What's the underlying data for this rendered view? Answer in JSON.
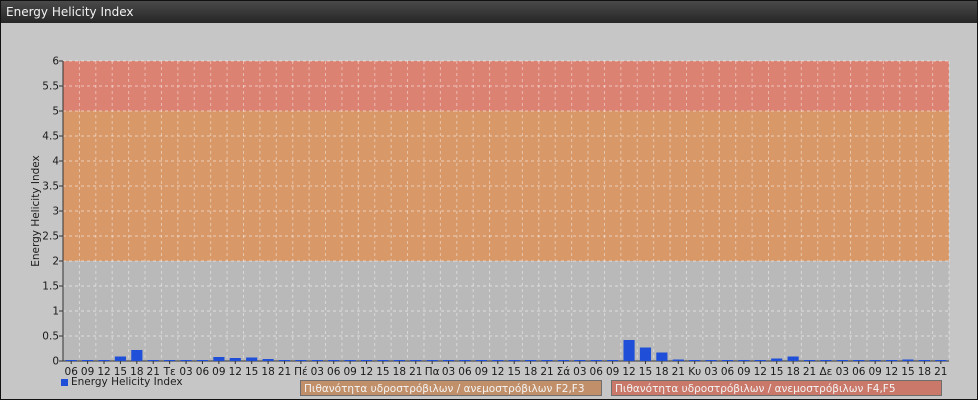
{
  "window": {
    "title": "Energy Helicity Index"
  },
  "chart_data": {
    "type": "bar",
    "ylabel": "Energy Helicity Index",
    "ylim": [
      0,
      6
    ],
    "yticks": [
      0,
      0.5,
      1,
      1.5,
      2,
      2.5,
      3,
      3.5,
      4,
      4.5,
      5,
      5.5,
      6
    ],
    "grid": true,
    "categories": [
      "06",
      "09",
      "12",
      "15",
      "18",
      "21",
      "Τε",
      "03",
      "06",
      "09",
      "12",
      "15",
      "18",
      "21",
      "Πέ",
      "03",
      "06",
      "09",
      "12",
      "15",
      "18",
      "21",
      "Πα",
      "03",
      "06",
      "09",
      "12",
      "15",
      "18",
      "21",
      "Σά",
      "03",
      "06",
      "09",
      "12",
      "15",
      "18",
      "21",
      "Κυ",
      "03",
      "06",
      "09",
      "12",
      "15",
      "18",
      "21",
      "Δε",
      "03",
      "06",
      "09",
      "12",
      "15",
      "18",
      "21"
    ],
    "series": [
      {
        "name": "Energy Helicity Index",
        "color": "#1f4fd8",
        "values": [
          0.01,
          0.01,
          0.01,
          0.09,
          0.22,
          0.01,
          0.01,
          0.01,
          0.01,
          0.08,
          0.06,
          0.07,
          0.04,
          0.01,
          0.01,
          0.01,
          0.01,
          0.01,
          0.01,
          0.01,
          0.01,
          0.01,
          0.01,
          0.01,
          0.01,
          0.01,
          0.01,
          0.01,
          0.02,
          0.01,
          0.01,
          0.01,
          0.01,
          0.01,
          0.42,
          0.27,
          0.17,
          0.03,
          0.01,
          0.01,
          0.01,
          0.01,
          0.01,
          0.05,
          0.09,
          0.01,
          0.01,
          0.01,
          0.01,
          0.01,
          0.02,
          0.03,
          0.02,
          0.01
        ]
      }
    ],
    "bands": [
      {
        "from": 0,
        "to": 2,
        "color": "#b9b9b9"
      },
      {
        "from": 2,
        "to": 5,
        "color": "#d89868"
      },
      {
        "from": 5,
        "to": 6,
        "color": "#dc8272"
      }
    ],
    "legend": [
      {
        "label": "Πιθανότητα υδροστρόβιλων / ανεμοστρόβιλων F2,F3",
        "color": "#c1906a"
      },
      {
        "label": "Πιθανότητα υδροστρόβιλων / ανεμοστρόβιλων F4,F5",
        "color": "#c9786a"
      }
    ]
  }
}
